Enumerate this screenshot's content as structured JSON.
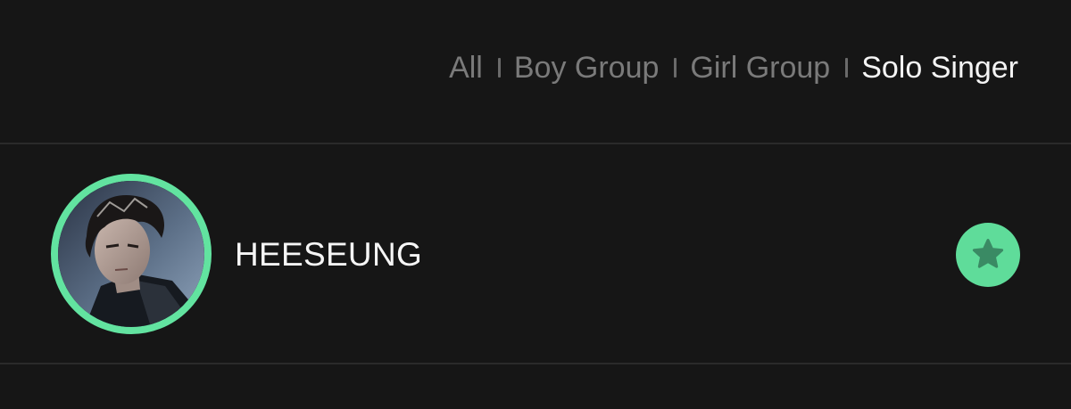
{
  "filters": {
    "items": [
      {
        "label": "All"
      },
      {
        "label": "Boy Group"
      },
      {
        "label": "Girl Group"
      },
      {
        "label": "Solo Singer"
      }
    ],
    "active": "Solo Singer"
  },
  "artist": {
    "name": "HEESEUNG",
    "favorited": true
  },
  "colors": {
    "background": "#161616",
    "accent": "#62e3a0",
    "active_text": "#f4f4f4",
    "inactive_text": "#7a7a7a",
    "star": "#3a8a64"
  },
  "icons": {
    "favorite": "star-icon",
    "separator": "divider-bar"
  }
}
